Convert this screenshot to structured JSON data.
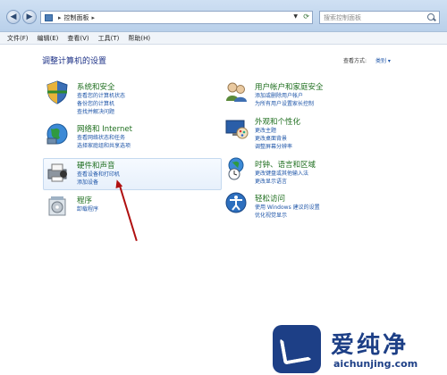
{
  "address_bar": {
    "path": "控制面板",
    "separator": "▸"
  },
  "search": {
    "placeholder": "搜索控制面板"
  },
  "menu": [
    "文件(F)",
    "编辑(E)",
    "查看(V)",
    "工具(T)",
    "帮助(H)"
  ],
  "content": {
    "heading": "调整计算机的设置",
    "view_by_label": "查看方式:",
    "view_by_value": "类别 ▾"
  },
  "categories": {
    "system_security": {
      "title": "系统和安全",
      "links": [
        "查看您的计算机状态",
        "备份您的计算机",
        "查找并解决问题"
      ]
    },
    "network": {
      "title": "网络和 Internet",
      "links": [
        "查看网络状态和任务",
        "选择家庭组和共享选项"
      ]
    },
    "hardware_sound": {
      "title": "硬件和声音",
      "links": [
        "查看设备和打印机",
        "添加设备"
      ]
    },
    "programs": {
      "title": "程序",
      "links": [
        "卸载程序"
      ]
    },
    "user_accounts": {
      "title": "用户帐户和家庭安全",
      "links": [
        "添加或删除用户帐户",
        "为所有用户设置家长控制"
      ]
    },
    "appearance": {
      "title": "外观和个性化",
      "links": [
        "更改主题",
        "更改桌面背景",
        "调整屏幕分辨率"
      ]
    },
    "clock_region": {
      "title": "时钟、语言和区域",
      "links": [
        "更改键盘或其他输入法",
        "更改显示语言"
      ]
    },
    "ease_access": {
      "title": "轻松访问",
      "links": [
        "使用 Windows 建议的设置",
        "优化视觉显示"
      ]
    }
  },
  "watermark": {
    "title": "爱纯净",
    "url": "aichunjing.com"
  },
  "colors": {
    "title_green": "#1e6e1e",
    "link_blue": "#1e55a8",
    "heading_blue": "#1e3287",
    "arrow_red": "#b01010"
  }
}
